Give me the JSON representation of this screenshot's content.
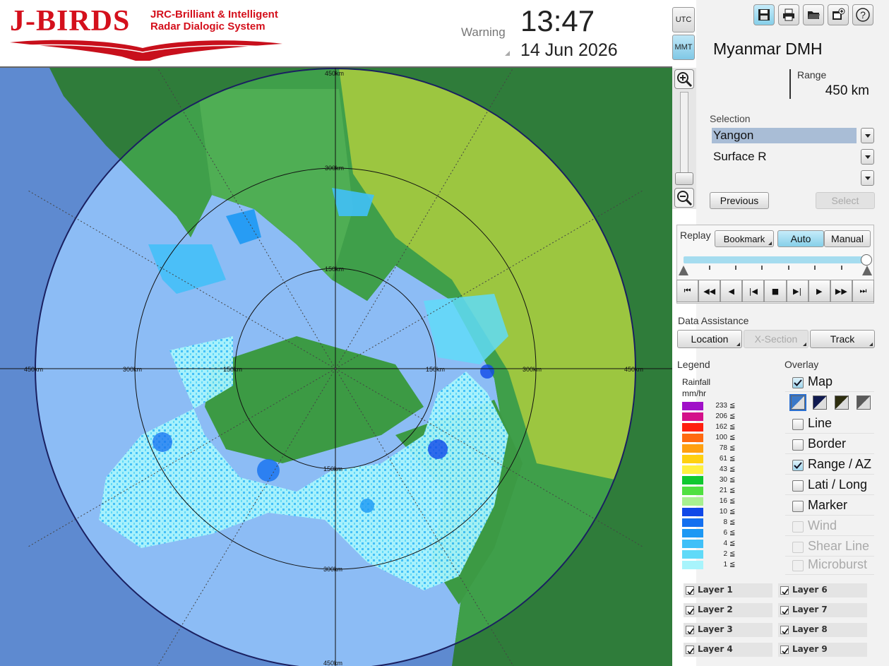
{
  "header": {
    "logo_main": "J-BIRDS",
    "logo_line1": "JRC-Brilliant & Intelligent",
    "logo_line2": "Radar Dialogic System",
    "warning": "Warning",
    "time": "13:47",
    "date": "14 Jun 2026"
  },
  "timezone": {
    "utc": "UTC",
    "mmt": "MMT",
    "active": "MMT"
  },
  "toolbar": [
    {
      "name": "save-icon",
      "active": true
    },
    {
      "name": "print-icon",
      "active": false
    },
    {
      "name": "open-folder-icon",
      "active": false
    },
    {
      "name": "add-window-icon",
      "active": false
    },
    {
      "name": "help-icon",
      "active": false
    }
  ],
  "station": "Myanmar DMH",
  "range": {
    "label": "Range",
    "value": "450 km"
  },
  "selection": {
    "label": "Selection",
    "site": "Yangon",
    "product": "Surface R",
    "third": "",
    "previous": "Previous",
    "select": "Select"
  },
  "replay": {
    "label": "Replay",
    "bookmark": "Bookmark",
    "auto": "Auto",
    "manual": "Manual",
    "controls": [
      "⏮",
      "◀◀",
      "◀",
      "|◀",
      "■",
      "▶|",
      "▶",
      "▶▶",
      "⏭"
    ]
  },
  "data_assistance": {
    "label": "Data Assistance",
    "location": "Location",
    "xsection": "X-Section",
    "track": "Track"
  },
  "legend": {
    "label": "Legend",
    "title1": "Rainfall",
    "title2": "mm/hr",
    "le": "≦",
    "items": [
      {
        "value": "233",
        "color": "#a010c8"
      },
      {
        "value": "206",
        "color": "#d4108a"
      },
      {
        "value": "162",
        "color": "#ff2010"
      },
      {
        "value": "100",
        "color": "#ff6a10"
      },
      {
        "value": "78",
        "color": "#ffa010"
      },
      {
        "value": "61",
        "color": "#ffd010"
      },
      {
        "value": "43",
        "color": "#fff040"
      },
      {
        "value": "30",
        "color": "#10c830"
      },
      {
        "value": "21",
        "color": "#50e040"
      },
      {
        "value": "16",
        "color": "#a8f090"
      },
      {
        "value": "10",
        "color": "#1048e8"
      },
      {
        "value": "8",
        "color": "#1470f0"
      },
      {
        "value": "6",
        "color": "#1c98f4"
      },
      {
        "value": "4",
        "color": "#40c0f8"
      },
      {
        "value": "2",
        "color": "#60daf8"
      },
      {
        "value": "1",
        "color": "#a8f4fc"
      }
    ]
  },
  "overlay": {
    "label": "Overlay",
    "items": [
      {
        "name": "map",
        "label": "Map",
        "checked": true,
        "disabled": false
      },
      {
        "name": "line",
        "label": "Line",
        "checked": false,
        "disabled": false
      },
      {
        "name": "border",
        "label": "Border",
        "checked": false,
        "disabled": false
      },
      {
        "name": "range-az",
        "label": "Range / AZ",
        "checked": true,
        "disabled": false
      },
      {
        "name": "lati-long",
        "label": "Lati / Long",
        "checked": false,
        "disabled": false
      },
      {
        "name": "marker",
        "label": "Marker",
        "checked": false,
        "disabled": false
      },
      {
        "name": "wind",
        "label": "Wind",
        "checked": false,
        "disabled": true
      },
      {
        "name": "shear-line",
        "label": "Shear Line",
        "checked": false,
        "disabled": true
      },
      {
        "name": "microburst",
        "label": "Microburst",
        "checked": false,
        "disabled": true
      }
    ],
    "map_styles": [
      "#3a78c8",
      "#101a50",
      "#2e2e10",
      "#5a5a5a"
    ]
  },
  "layers": [
    "Layer 1",
    "Layer 6",
    "Layer 2",
    "Layer 7",
    "Layer 3",
    "Layer 8",
    "Layer 4",
    "Layer 9"
  ],
  "map": {
    "range_labels": [
      "450km",
      "300km",
      "150km",
      "150km",
      "300km",
      "450km",
      "450km",
      "300km",
      "150km",
      "150km",
      "300km",
      "450km"
    ],
    "colors": {
      "sea": "#5e8ad0",
      "sea_light": "#8cbcf5",
      "land_dark": "#2f8a3e",
      "land_mid": "#3f9f4a",
      "land_light": "#9cc640",
      "echo_light": "#a8f4fc",
      "echo_mid": "#40c0f8",
      "echo_dark": "#1048e8"
    }
  }
}
